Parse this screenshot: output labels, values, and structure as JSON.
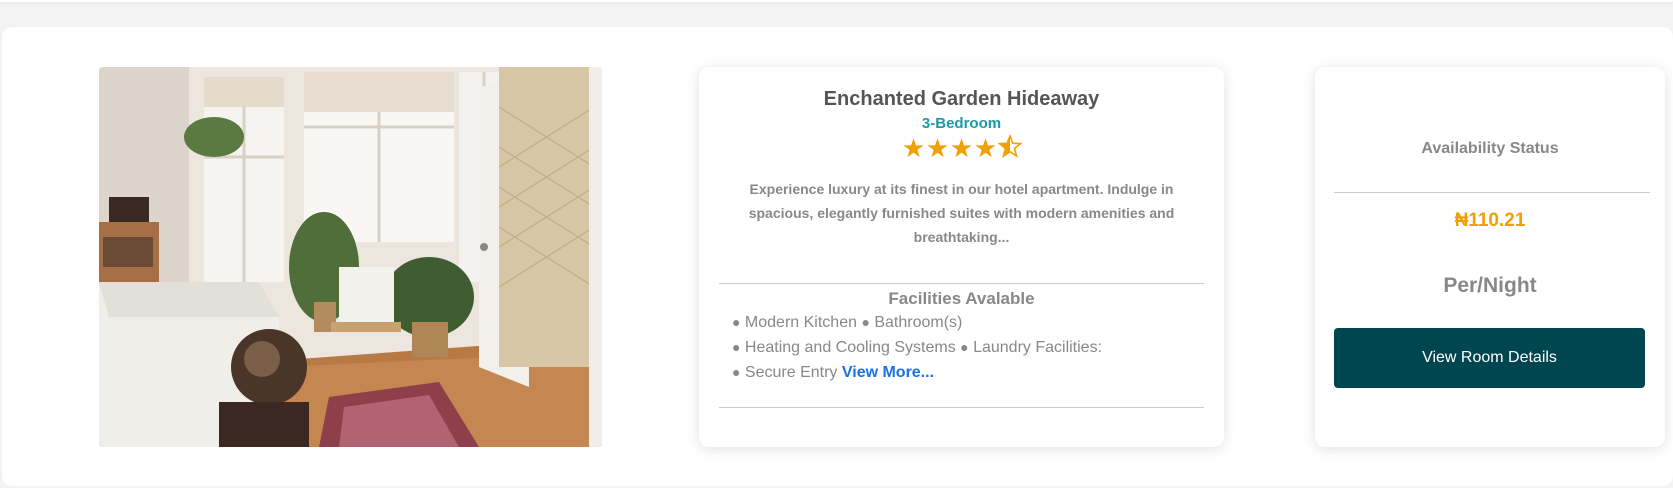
{
  "listing": {
    "name": "Enchanted Garden Hideaway",
    "type": "3-Bedroom",
    "rating": {
      "value": 4.5,
      "max": 5,
      "stars": [
        "★",
        "★",
        "★",
        "★"
      ]
    },
    "description_lines": [
      "Experience luxury at its finest in our hotel apartment. Indulge in",
      "spacious, elegantly furnished suites with modern amenities and",
      "breathtaking..."
    ],
    "facilities_title": "Facilities Avalable",
    "facilities": {
      "bullet": "●",
      "row1": [
        "Modern Kitchen",
        "Bathroom(s)"
      ],
      "row2": [
        "Heating and Cooling Systems",
        "Laundry Facilities:"
      ],
      "row3": [
        "Secure Entry"
      ],
      "view_more": "View More..."
    }
  },
  "booking": {
    "availability_label": "Availability Status",
    "price": "₦110.21",
    "per_night": "Per/Night",
    "button_label": "View Room Details"
  },
  "colors": {
    "accent_teal": "#1a9aa3",
    "star_orange": "#f0a000",
    "button_dark_teal": "#004650",
    "link_blue": "#1a72e8"
  }
}
